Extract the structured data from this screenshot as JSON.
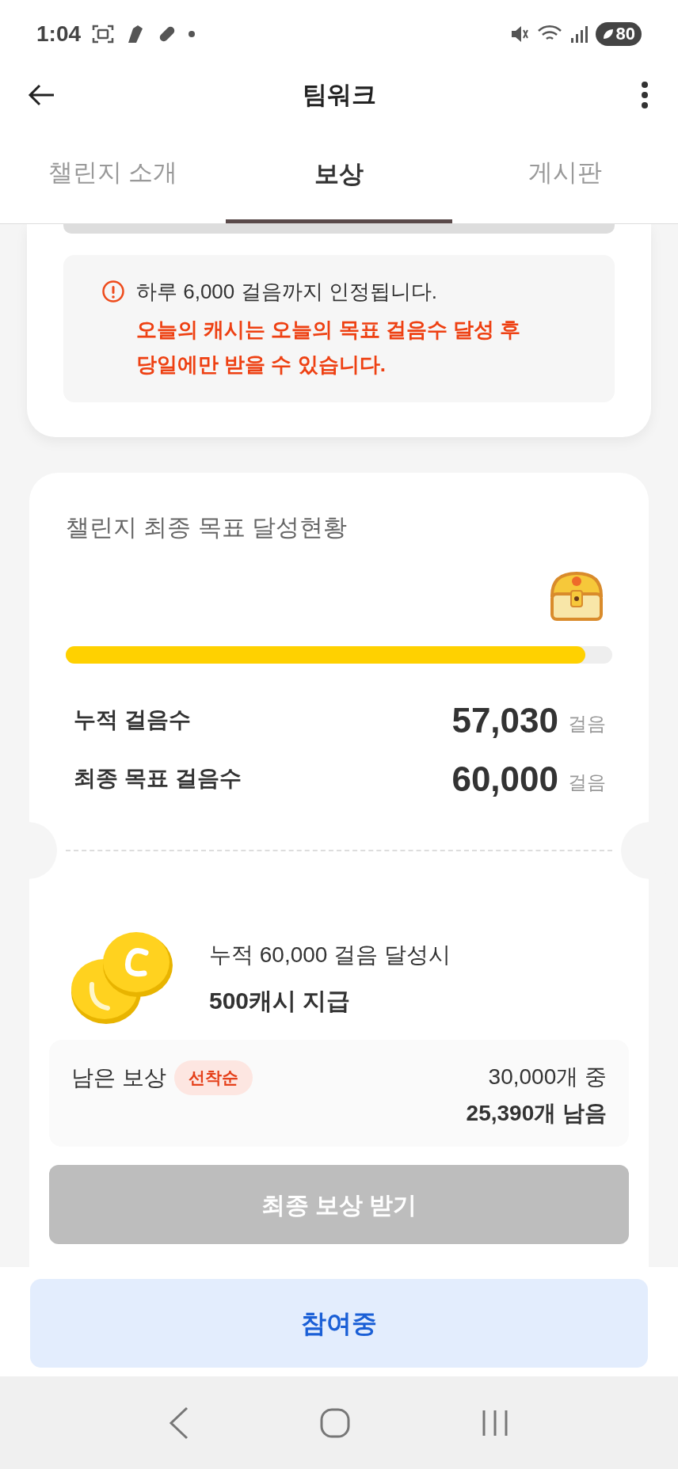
{
  "status_bar": {
    "time": "1:04",
    "battery": "80"
  },
  "header": {
    "title": "팀워크"
  },
  "tabs": [
    {
      "label": "챌린지 소개",
      "selected": false
    },
    {
      "label": "보상",
      "selected": true
    },
    {
      "label": "게시판",
      "selected": false
    }
  ],
  "notice": {
    "info": "하루 6,000 걸음까지 인정됩니다.",
    "warning": "오늘의 캐시는 오늘의 목표 걸음수 달성 후 당일에만 받을 수 있습니다."
  },
  "goal": {
    "title": "챌린지 최종 목표 달성현황",
    "level": 0.95,
    "rows": [
      {
        "label": "누적 걸음수",
        "value": "57,030",
        "unit": "걸음"
      },
      {
        "label": "최종 목표 걸음수",
        "value": "60,000",
        "unit": "걸음"
      }
    ],
    "reward": {
      "condition": "누적 60,000 걸음 달성시",
      "amount": "500캐시 지급"
    },
    "remaining": {
      "label": "남은 보상",
      "badge": "선착순",
      "total": "30,000개 중",
      "left": "25,390개 남음"
    },
    "claim_button": {
      "label": "최종 보상 받기",
      "disabled": true
    }
  },
  "join_button": {
    "label": "참여중"
  }
}
